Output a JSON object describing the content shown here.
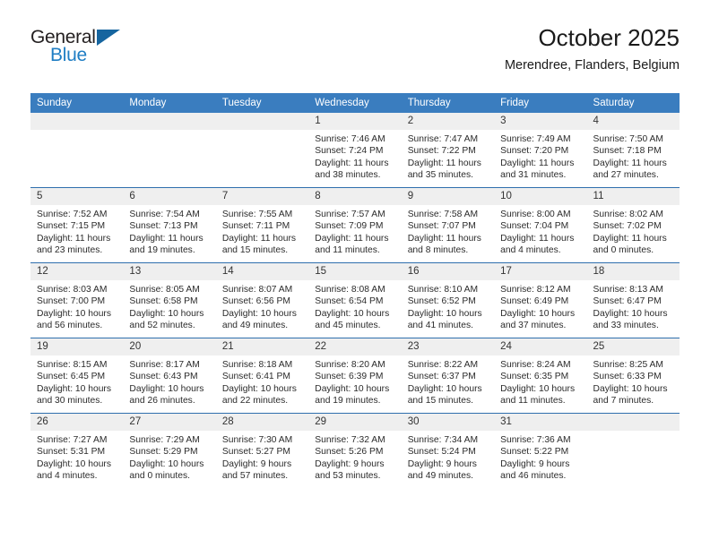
{
  "brand": {
    "name_top": "General",
    "name_bottom": "Blue",
    "triangle_color": "#16659f",
    "blue_color": "#1f7ec4"
  },
  "header": {
    "title": "October 2025",
    "subtitle": "Merendree, Flanders, Belgium"
  },
  "theme": {
    "header_row_bg": "#3a7dbf",
    "week_divider": "#2f6fad",
    "daynum_bg": "#efefef"
  },
  "weekday_headers": [
    "Sunday",
    "Monday",
    "Tuesday",
    "Wednesday",
    "Thursday",
    "Friday",
    "Saturday"
  ],
  "weeks": [
    [
      {
        "day": "",
        "sunrise": "",
        "sunset": "",
        "daylight_line1": "",
        "daylight_line2": ""
      },
      {
        "day": "",
        "sunrise": "",
        "sunset": "",
        "daylight_line1": "",
        "daylight_line2": ""
      },
      {
        "day": "",
        "sunrise": "",
        "sunset": "",
        "daylight_line1": "",
        "daylight_line2": ""
      },
      {
        "day": "1",
        "sunrise": "Sunrise: 7:46 AM",
        "sunset": "Sunset: 7:24 PM",
        "daylight_line1": "Daylight: 11 hours",
        "daylight_line2": "and 38 minutes."
      },
      {
        "day": "2",
        "sunrise": "Sunrise: 7:47 AM",
        "sunset": "Sunset: 7:22 PM",
        "daylight_line1": "Daylight: 11 hours",
        "daylight_line2": "and 35 minutes."
      },
      {
        "day": "3",
        "sunrise": "Sunrise: 7:49 AM",
        "sunset": "Sunset: 7:20 PM",
        "daylight_line1": "Daylight: 11 hours",
        "daylight_line2": "and 31 minutes."
      },
      {
        "day": "4",
        "sunrise": "Sunrise: 7:50 AM",
        "sunset": "Sunset: 7:18 PM",
        "daylight_line1": "Daylight: 11 hours",
        "daylight_line2": "and 27 minutes."
      }
    ],
    [
      {
        "day": "5",
        "sunrise": "Sunrise: 7:52 AM",
        "sunset": "Sunset: 7:15 PM",
        "daylight_line1": "Daylight: 11 hours",
        "daylight_line2": "and 23 minutes."
      },
      {
        "day": "6",
        "sunrise": "Sunrise: 7:54 AM",
        "sunset": "Sunset: 7:13 PM",
        "daylight_line1": "Daylight: 11 hours",
        "daylight_line2": "and 19 minutes."
      },
      {
        "day": "7",
        "sunrise": "Sunrise: 7:55 AM",
        "sunset": "Sunset: 7:11 PM",
        "daylight_line1": "Daylight: 11 hours",
        "daylight_line2": "and 15 minutes."
      },
      {
        "day": "8",
        "sunrise": "Sunrise: 7:57 AM",
        "sunset": "Sunset: 7:09 PM",
        "daylight_line1": "Daylight: 11 hours",
        "daylight_line2": "and 11 minutes."
      },
      {
        "day": "9",
        "sunrise": "Sunrise: 7:58 AM",
        "sunset": "Sunset: 7:07 PM",
        "daylight_line1": "Daylight: 11 hours",
        "daylight_line2": "and 8 minutes."
      },
      {
        "day": "10",
        "sunrise": "Sunrise: 8:00 AM",
        "sunset": "Sunset: 7:04 PM",
        "daylight_line1": "Daylight: 11 hours",
        "daylight_line2": "and 4 minutes."
      },
      {
        "day": "11",
        "sunrise": "Sunrise: 8:02 AM",
        "sunset": "Sunset: 7:02 PM",
        "daylight_line1": "Daylight: 11 hours",
        "daylight_line2": "and 0 minutes."
      }
    ],
    [
      {
        "day": "12",
        "sunrise": "Sunrise: 8:03 AM",
        "sunset": "Sunset: 7:00 PM",
        "daylight_line1": "Daylight: 10 hours",
        "daylight_line2": "and 56 minutes."
      },
      {
        "day": "13",
        "sunrise": "Sunrise: 8:05 AM",
        "sunset": "Sunset: 6:58 PM",
        "daylight_line1": "Daylight: 10 hours",
        "daylight_line2": "and 52 minutes."
      },
      {
        "day": "14",
        "sunrise": "Sunrise: 8:07 AM",
        "sunset": "Sunset: 6:56 PM",
        "daylight_line1": "Daylight: 10 hours",
        "daylight_line2": "and 49 minutes."
      },
      {
        "day": "15",
        "sunrise": "Sunrise: 8:08 AM",
        "sunset": "Sunset: 6:54 PM",
        "daylight_line1": "Daylight: 10 hours",
        "daylight_line2": "and 45 minutes."
      },
      {
        "day": "16",
        "sunrise": "Sunrise: 8:10 AM",
        "sunset": "Sunset: 6:52 PM",
        "daylight_line1": "Daylight: 10 hours",
        "daylight_line2": "and 41 minutes."
      },
      {
        "day": "17",
        "sunrise": "Sunrise: 8:12 AM",
        "sunset": "Sunset: 6:49 PM",
        "daylight_line1": "Daylight: 10 hours",
        "daylight_line2": "and 37 minutes."
      },
      {
        "day": "18",
        "sunrise": "Sunrise: 8:13 AM",
        "sunset": "Sunset: 6:47 PM",
        "daylight_line1": "Daylight: 10 hours",
        "daylight_line2": "and 33 minutes."
      }
    ],
    [
      {
        "day": "19",
        "sunrise": "Sunrise: 8:15 AM",
        "sunset": "Sunset: 6:45 PM",
        "daylight_line1": "Daylight: 10 hours",
        "daylight_line2": "and 30 minutes."
      },
      {
        "day": "20",
        "sunrise": "Sunrise: 8:17 AM",
        "sunset": "Sunset: 6:43 PM",
        "daylight_line1": "Daylight: 10 hours",
        "daylight_line2": "and 26 minutes."
      },
      {
        "day": "21",
        "sunrise": "Sunrise: 8:18 AM",
        "sunset": "Sunset: 6:41 PM",
        "daylight_line1": "Daylight: 10 hours",
        "daylight_line2": "and 22 minutes."
      },
      {
        "day": "22",
        "sunrise": "Sunrise: 8:20 AM",
        "sunset": "Sunset: 6:39 PM",
        "daylight_line1": "Daylight: 10 hours",
        "daylight_line2": "and 19 minutes."
      },
      {
        "day": "23",
        "sunrise": "Sunrise: 8:22 AM",
        "sunset": "Sunset: 6:37 PM",
        "daylight_line1": "Daylight: 10 hours",
        "daylight_line2": "and 15 minutes."
      },
      {
        "day": "24",
        "sunrise": "Sunrise: 8:24 AM",
        "sunset": "Sunset: 6:35 PM",
        "daylight_line1": "Daylight: 10 hours",
        "daylight_line2": "and 11 minutes."
      },
      {
        "day": "25",
        "sunrise": "Sunrise: 8:25 AM",
        "sunset": "Sunset: 6:33 PM",
        "daylight_line1": "Daylight: 10 hours",
        "daylight_line2": "and 7 minutes."
      }
    ],
    [
      {
        "day": "26",
        "sunrise": "Sunrise: 7:27 AM",
        "sunset": "Sunset: 5:31 PM",
        "daylight_line1": "Daylight: 10 hours",
        "daylight_line2": "and 4 minutes."
      },
      {
        "day": "27",
        "sunrise": "Sunrise: 7:29 AM",
        "sunset": "Sunset: 5:29 PM",
        "daylight_line1": "Daylight: 10 hours",
        "daylight_line2": "and 0 minutes."
      },
      {
        "day": "28",
        "sunrise": "Sunrise: 7:30 AM",
        "sunset": "Sunset: 5:27 PM",
        "daylight_line1": "Daylight: 9 hours",
        "daylight_line2": "and 57 minutes."
      },
      {
        "day": "29",
        "sunrise": "Sunrise: 7:32 AM",
        "sunset": "Sunset: 5:26 PM",
        "daylight_line1": "Daylight: 9 hours",
        "daylight_line2": "and 53 minutes."
      },
      {
        "day": "30",
        "sunrise": "Sunrise: 7:34 AM",
        "sunset": "Sunset: 5:24 PM",
        "daylight_line1": "Daylight: 9 hours",
        "daylight_line2": "and 49 minutes."
      },
      {
        "day": "31",
        "sunrise": "Sunrise: 7:36 AM",
        "sunset": "Sunset: 5:22 PM",
        "daylight_line1": "Daylight: 9 hours",
        "daylight_line2": "and 46 minutes."
      },
      {
        "day": "",
        "sunrise": "",
        "sunset": "",
        "daylight_line1": "",
        "daylight_line2": ""
      }
    ]
  ]
}
